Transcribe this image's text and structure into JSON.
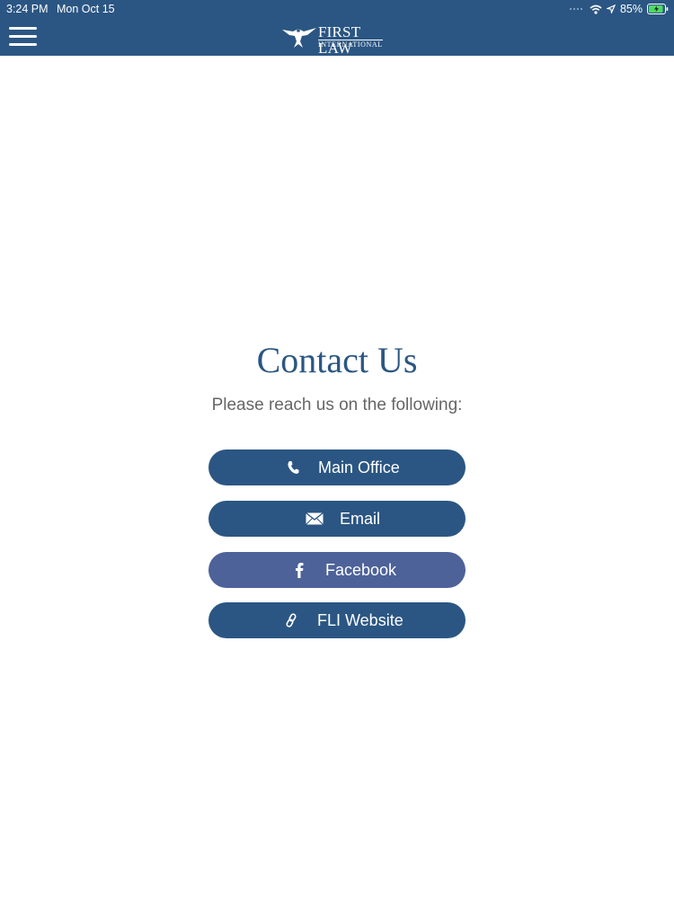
{
  "status_bar": {
    "time": "3:24 PM",
    "date": "Mon Oct 15",
    "battery_percent": "85%",
    "icons": [
      "signal-dots-icon",
      "wifi-icon",
      "location-arrow-icon",
      "battery-charging-icon"
    ]
  },
  "header": {
    "menu_icon": "hamburger-menu-icon",
    "logo_line1": "FIRST LAW",
    "logo_line2": "INTERNATIONAL",
    "background_color": "#2b5683"
  },
  "content": {
    "title": "Contact Us",
    "subtitle": "Please reach us on the following:",
    "buttons": [
      {
        "label": "Main Office",
        "icon": "phone-icon",
        "color": "#2b5683"
      },
      {
        "label": "Email",
        "icon": "envelope-icon",
        "color": "#2b5683"
      },
      {
        "label": "Facebook",
        "icon": "facebook-icon",
        "color": "#4d6298"
      },
      {
        "label": "FLI Website",
        "icon": "link-icon",
        "color": "#2b5683"
      }
    ]
  }
}
